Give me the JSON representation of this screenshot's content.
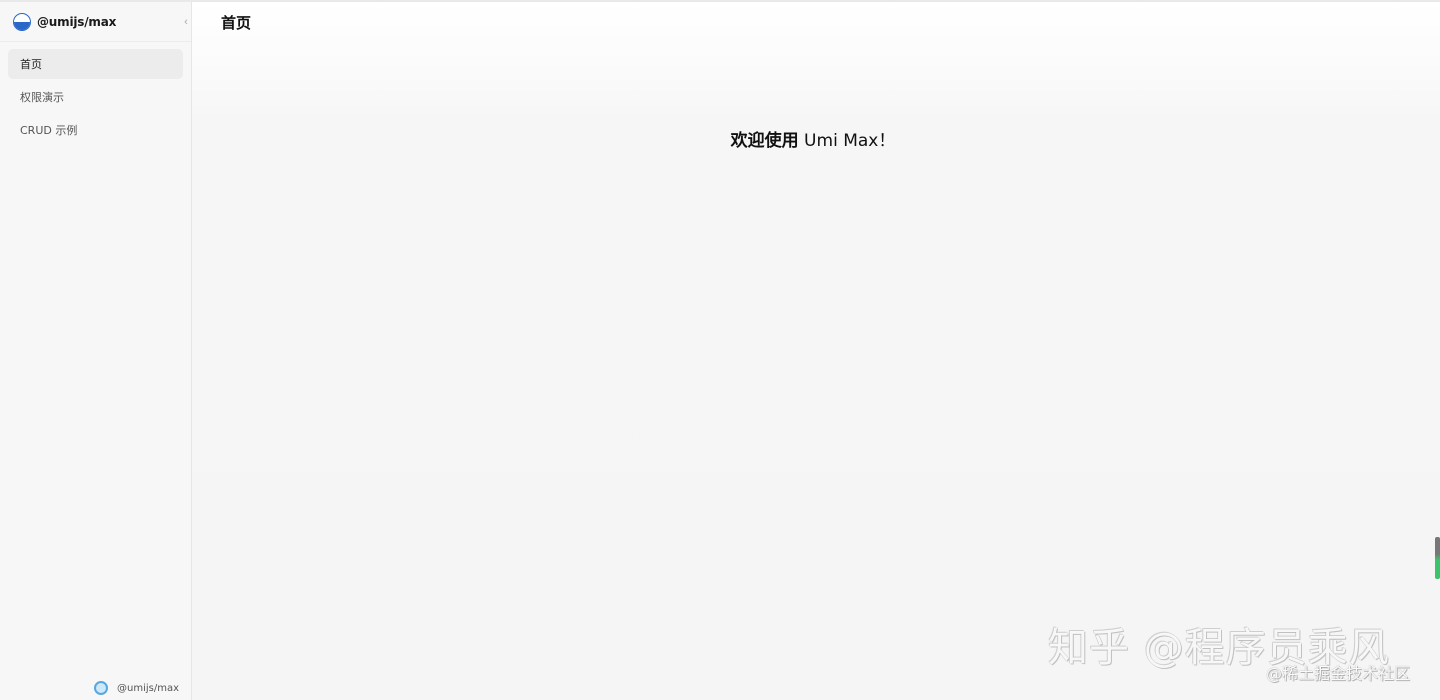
{
  "sidebar": {
    "brand": "@umijs/max",
    "collapse_glyph": "‹",
    "items": [
      {
        "label": "首页",
        "active": true
      },
      {
        "label": "权限演示",
        "active": false
      },
      {
        "label": "CRUD 示例",
        "active": false
      }
    ],
    "footer_text": "@umijs/max"
  },
  "header": {
    "title": "首页"
  },
  "main": {
    "welcome_bold": "欢迎使用",
    "welcome_rest": " Umi Max！"
  },
  "watermark": {
    "main": "知乎 @程序员乘风",
    "sub": "@稀土掘金技术社区"
  },
  "colors": {
    "logo_blue": "#2a67c9",
    "scroll_green": "#3cc36e"
  }
}
